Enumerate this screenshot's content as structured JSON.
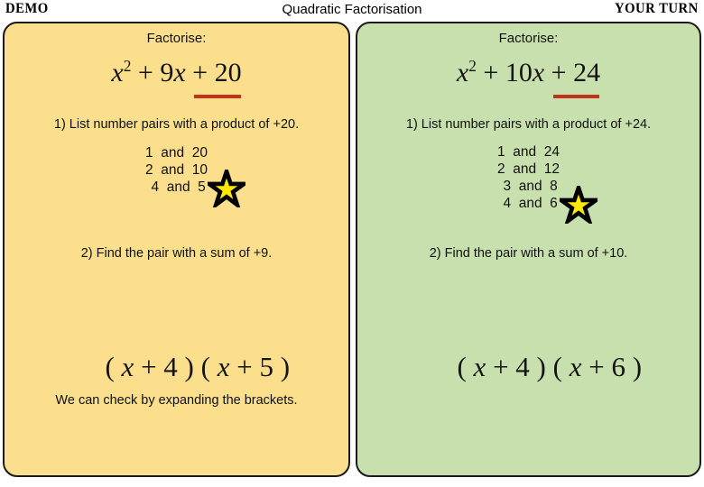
{
  "header": {
    "left_badge": "DEMO",
    "title": "Quadratic Factorisation",
    "right_badge": "YOUR TURN"
  },
  "colors": {
    "demo_panel_fill": "#fbdf8d",
    "your_turn_panel_fill": "#c8e0ad",
    "panel_border": "#1a1a1a",
    "underline_red": "#c4301a",
    "star_fill": "#ffe800",
    "star_outline": "#000000"
  },
  "panels": [
    {
      "id": "demo",
      "factorise_label": "Factorise:",
      "equation": {
        "full": "x² + 9x + 20",
        "variable": "x",
        "exponent": "2",
        "middle_op": "+",
        "middle_coefficient": "9",
        "constant_op": "+",
        "constant": "20",
        "underlined_part": "+ 20"
      },
      "step1": "1) List number pairs with a product of +20.",
      "pairs": [
        {
          "a": "1",
          "b": "20",
          "text": "1  and  20",
          "starred": false
        },
        {
          "a": "2",
          "b": "10",
          "text": "2  and  10",
          "starred": false
        },
        {
          "a": "4",
          "b": "5",
          "text": " 4  and  5",
          "starred": true
        }
      ],
      "step2": "2) Find the pair with a sum of +9.",
      "factored": "( x  + 4 ) ( x  + 5 )",
      "factored_parts": {
        "first_bracket": "( x  + 4 )",
        "second_bracket": "( x  + 5 )"
      },
      "check_text": "We can check by expanding the brackets."
    },
    {
      "id": "your-turn",
      "factorise_label": "Factorise:",
      "equation": {
        "full": "x² + 10x + 24",
        "variable": "x",
        "exponent": "2",
        "middle_op": "+",
        "middle_coefficient": "10",
        "constant_op": "+",
        "constant": "24",
        "underlined_part": "+ 24"
      },
      "step1": "1) List number pairs with a product of +24.",
      "pairs": [
        {
          "a": "1",
          "b": "24",
          "text": "1  and  24",
          "starred": false
        },
        {
          "a": "2",
          "b": "12",
          "text": "2  and  12",
          "starred": false
        },
        {
          "a": "3",
          "b": "8",
          "text": " 3  and  8",
          "starred": false
        },
        {
          "a": "4",
          "b": "6",
          "text": " 4  and  6",
          "starred": true
        }
      ],
      "step2": "2) Find the pair with a sum of +10.",
      "factored": "( x  + 4 ) ( x  + 6 )",
      "factored_parts": {
        "first_bracket": "( x  + 4 )",
        "second_bracket": "( x  + 6 )"
      },
      "check_text": ""
    }
  ],
  "icons": {
    "star": "five-pointed-star"
  }
}
